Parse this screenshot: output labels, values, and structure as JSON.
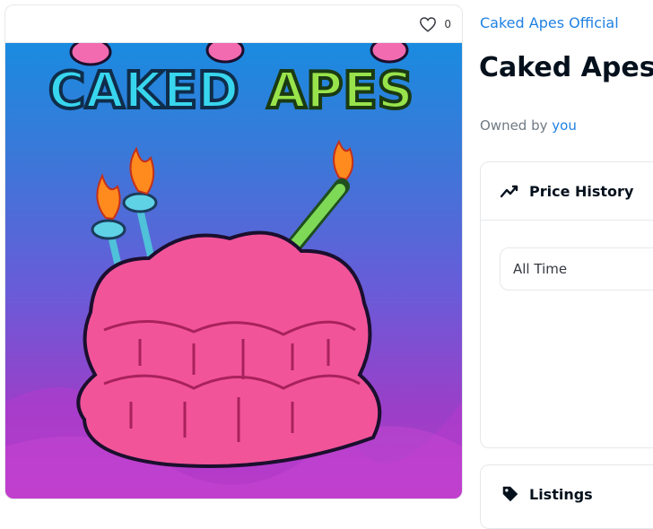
{
  "favorites": {
    "count": "0"
  },
  "artwork": {
    "title_left": "CAKED",
    "title_right": "APES"
  },
  "collection": {
    "name": "Caked Apes Official"
  },
  "item": {
    "name": "Caked Apes"
  },
  "owner": {
    "prefix": "Owned by",
    "name": "you"
  },
  "price_history": {
    "title": "Price History",
    "range_selected": "All Time"
  },
  "listings": {
    "title": "Listings"
  },
  "colors": {
    "accent": "#2081e2",
    "text": "#04111d",
    "muted": "#707a83",
    "border": "#e5e8eb"
  }
}
